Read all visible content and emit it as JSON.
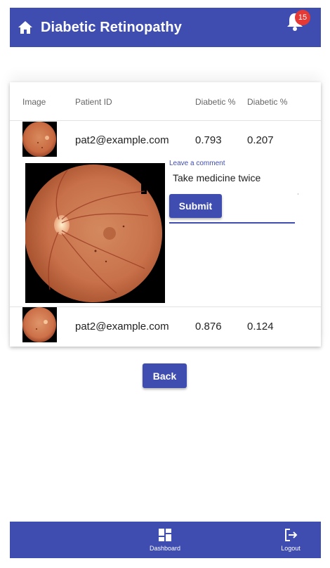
{
  "app_bar": {
    "title": "Diabetic Retinopathy",
    "notification_count": "15"
  },
  "table": {
    "headers": [
      "Image",
      "Patient ID",
      "Diabetic %",
      "Diabetic %"
    ],
    "rows": [
      {
        "patient_id": "pat2@example.com",
        "diabetic_pct_a": "0.793",
        "diabetic_pct_b": "0.207"
      },
      {
        "patient_id": "pat2@example.com",
        "diabetic_pct_a": "0.876",
        "diabetic_pct_b": "0.124"
      }
    ]
  },
  "comment": {
    "label": "Leave a comment",
    "value": "Take medicine twice",
    "submit_label": "Submit"
  },
  "back_label": "Back",
  "bottom_nav": {
    "items": [
      {
        "label": "Dashboard",
        "icon": "dashboard-icon"
      },
      {
        "label": "Logout",
        "icon": "logout-icon"
      }
    ]
  },
  "colors": {
    "primary": "#3f4db0",
    "badge": "#e53935"
  }
}
